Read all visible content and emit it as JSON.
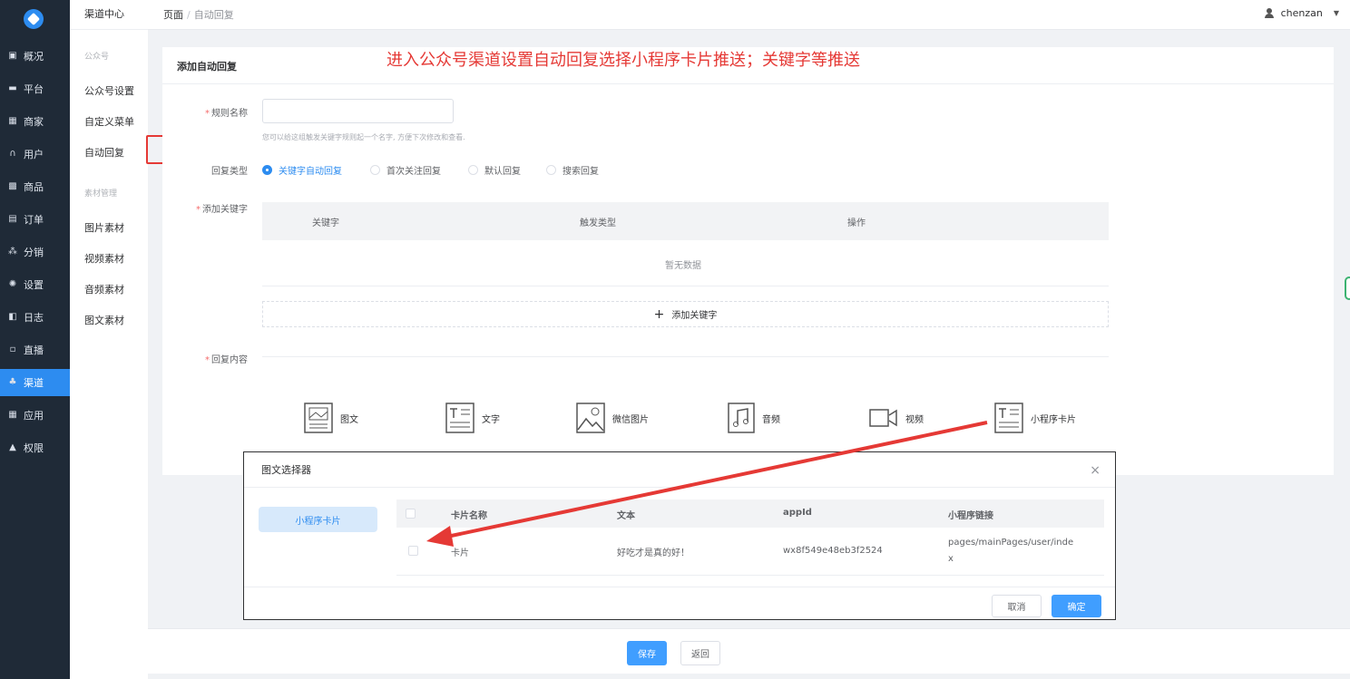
{
  "sidebar": {
    "items": [
      {
        "label": "概况",
        "icon": "dashboard-icon",
        "glyph": "▣"
      },
      {
        "label": "平台",
        "icon": "monitor-icon",
        "glyph": "▬"
      },
      {
        "label": "商家",
        "icon": "store-icon",
        "glyph": "▦"
      },
      {
        "label": "用户",
        "icon": "headset-icon",
        "glyph": "∩"
      },
      {
        "label": "商品",
        "icon": "goods-icon",
        "glyph": "▩"
      },
      {
        "label": "订单",
        "icon": "order-icon",
        "glyph": "▤"
      },
      {
        "label": "分销",
        "icon": "network-icon",
        "glyph": "⁂"
      },
      {
        "label": "设置",
        "icon": "gear-icon",
        "glyph": "✺"
      },
      {
        "label": "日志",
        "icon": "log-icon",
        "glyph": "◧"
      },
      {
        "label": "直播",
        "icon": "live-icon",
        "glyph": "▫"
      },
      {
        "label": "渠道",
        "icon": "channel-icon",
        "glyph": "♣"
      },
      {
        "label": "应用",
        "icon": "apps-icon",
        "glyph": "▦"
      },
      {
        "label": "权限",
        "icon": "lock-icon",
        "glyph": "▲"
      }
    ],
    "active_index": 10
  },
  "submenu": {
    "title": "渠道中心",
    "group1": "公众号",
    "items1": [
      "公众号设置",
      "自定义菜单",
      "自动回复"
    ],
    "group2": "素材管理",
    "items2": [
      "图片素材",
      "视频素材",
      "音频素材",
      "图文素材"
    ]
  },
  "topbar": {
    "breadcrumb_root": "页面",
    "breadcrumb_sep": "/",
    "breadcrumb_current": "自动回复",
    "username": "chenzan",
    "caret": "▼"
  },
  "card": {
    "title": "添加自动回复",
    "annotation": "进入公众号渠道设置自动回复选择小程序卡片推送；关键字等推送"
  },
  "form": {
    "rule_name_label": "规则名称",
    "rule_name_value": "",
    "rule_name_hint": "您可以给这组触发关键字规则起一个名字, 方便下次修改和查看.",
    "reply_type_label": "回复类型",
    "reply_types": [
      "关键字自动回复",
      "首次关注回复",
      "默认回复",
      "搜索回复"
    ],
    "reply_type_selected": 0,
    "add_keyword_label": "添加关键字",
    "keyword_columns": [
      "关键字",
      "触发类型",
      "操作"
    ],
    "keyword_empty": "暂无数据",
    "add_keyword_button": "添加关键字",
    "add_keyword_plus": "+",
    "reply_content_label": "回复内容",
    "required_mark": "*",
    "content_types": [
      {
        "label": "图文",
        "icon": "image-text-icon"
      },
      {
        "label": "文字",
        "icon": "text-icon"
      },
      {
        "label": "微信图片",
        "icon": "picture-icon"
      },
      {
        "label": "音频",
        "icon": "music-icon"
      },
      {
        "label": "视频",
        "icon": "video-icon"
      },
      {
        "label": "小程序卡片",
        "icon": "mini-program-card-icon"
      }
    ]
  },
  "modal": {
    "title": "图文选择器",
    "close": "×",
    "tab": "小程序卡片",
    "columns": [
      "卡片名称",
      "文本",
      "appId",
      "小程序链接"
    ],
    "rows": [
      {
        "name": "卡片",
        "text": "好吃才是真的好！",
        "appid": "wx8f549e48eb3f2524",
        "link_line1": "pages/mainPages/user/inde",
        "link_line2": "x"
      }
    ],
    "cancel": "取消",
    "confirm": "确定"
  },
  "footer": {
    "save": "保存",
    "back": "返回"
  },
  "colors": {
    "sidebar_bg": "#1f2a37",
    "accent": "#409eff",
    "annotation": "#e53935"
  }
}
